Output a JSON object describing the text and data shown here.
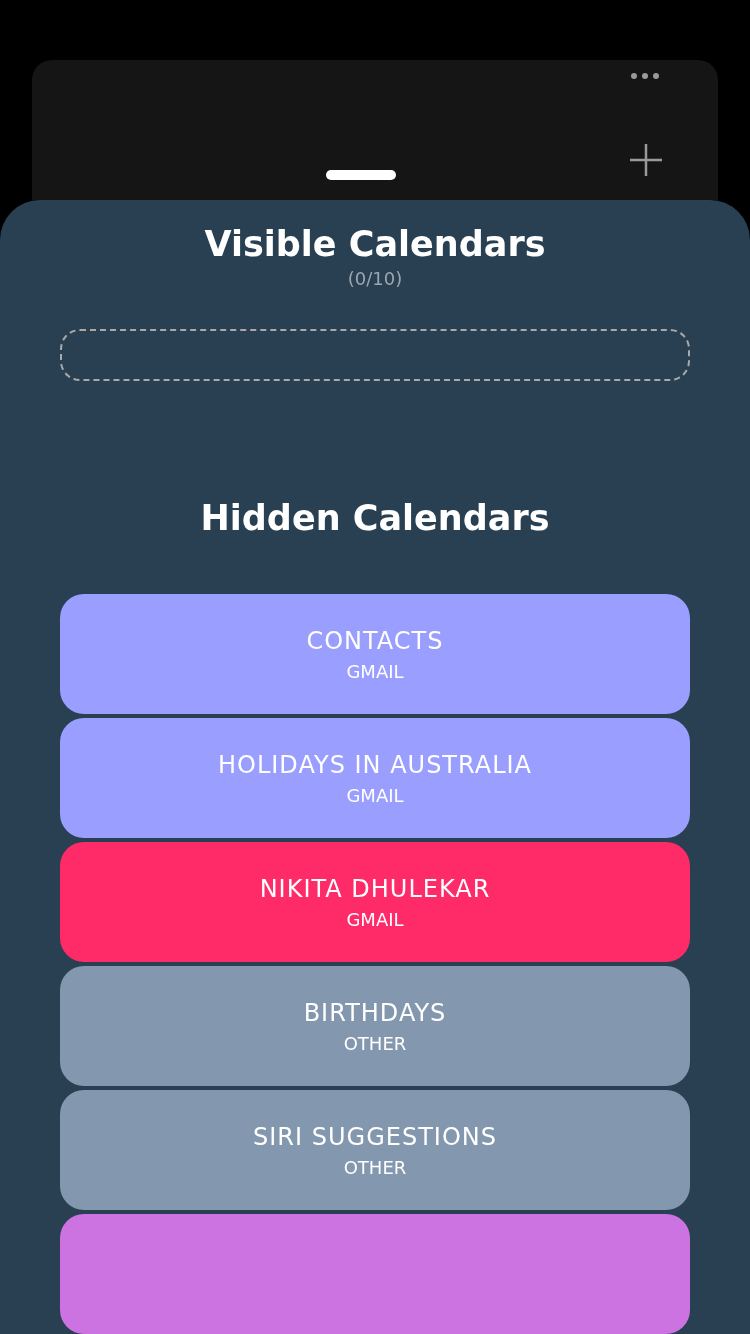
{
  "visible_section": {
    "title": "Visible Calendars",
    "count": "(0/10)"
  },
  "hidden_section": {
    "title": "Hidden Calendars"
  },
  "hidden_calendars": [
    {
      "name": "CONTACTS",
      "account": "GMAIL",
      "color": "#9a9eff"
    },
    {
      "name": "HOLIDAYS IN AUSTRALIA",
      "account": "GMAIL",
      "color": "#9a9eff"
    },
    {
      "name": "NIKITA DHULEKAR",
      "account": "GMAIL",
      "color": "#ff2a68"
    },
    {
      "name": "BIRTHDAYS",
      "account": "OTHER",
      "color": "#8397ae"
    },
    {
      "name": "SIRI SUGGESTIONS",
      "account": "OTHER",
      "color": "#8397ae"
    },
    {
      "color": "#cc73e1"
    }
  ]
}
